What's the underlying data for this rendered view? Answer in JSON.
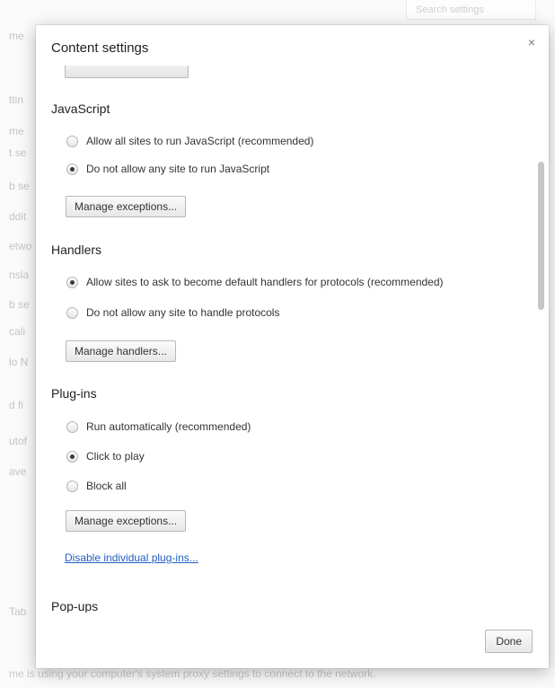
{
  "background": {
    "search_placeholder": "Search settings",
    "fragments": [
      "me",
      "ttin",
      "me",
      "t se",
      "b se",
      "ddit",
      "etwo",
      "nsla",
      "b se",
      "cali",
      "lo N",
      "d fi",
      "utof",
      "ave",
      "Tab"
    ],
    "footer_text": "me is using your computer's system proxy settings to connect to the network."
  },
  "dialog": {
    "title": "Content settings",
    "close_label": "×",
    "done_label": "Done"
  },
  "javascript": {
    "title": "JavaScript",
    "options": [
      {
        "label": "Allow all sites to run JavaScript (recommended)",
        "checked": false
      },
      {
        "label": "Do not allow any site to run JavaScript",
        "checked": true
      }
    ],
    "button_label": "Manage exceptions..."
  },
  "handlers": {
    "title": "Handlers",
    "options": [
      {
        "label": "Allow sites to ask to become default handlers for protocols (recommended)",
        "checked": true
      },
      {
        "label": "Do not allow any site to handle protocols",
        "checked": false
      }
    ],
    "button_label": "Manage handlers..."
  },
  "plugins": {
    "title": "Plug-ins",
    "options": [
      {
        "label": "Run automatically (recommended)",
        "checked": false
      },
      {
        "label": "Click to play",
        "checked": true
      },
      {
        "label": "Block all",
        "checked": false
      }
    ],
    "button_label": "Manage exceptions...",
    "link_label": "Disable individual plug-ins..."
  },
  "popups": {
    "title": "Pop-ups"
  }
}
